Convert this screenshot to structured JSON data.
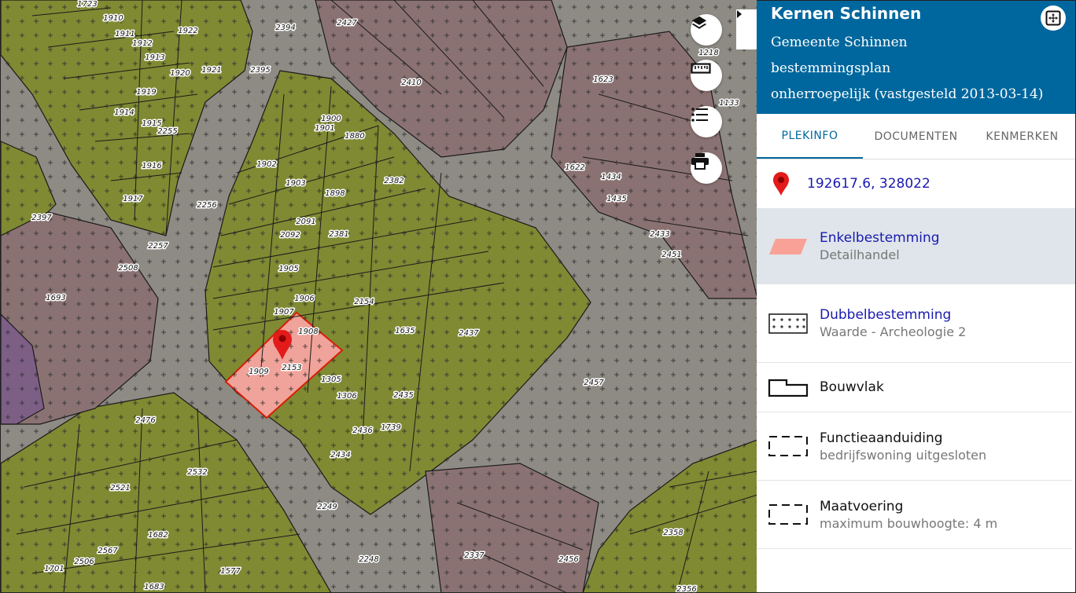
{
  "map": {
    "parcels": [
      "1723",
      "1910",
      "1911",
      "1912",
      "1913",
      "1922",
      "1920",
      "1921",
      "1919",
      "1914",
      "1915",
      "2255",
      "1916",
      "1917",
      "2256",
      "2397",
      "2257",
      "2508",
      "1693",
      "2394",
      "2395",
      "2427",
      "2410",
      "1623",
      "1218",
      "1133",
      "1622",
      "1434",
      "1435",
      "2433",
      "2451",
      "1900",
      "1901",
      "1880",
      "1902",
      "1903",
      "1898",
      "2382",
      "2091",
      "2092",
      "2381",
      "1905",
      "1906",
      "2154",
      "1907",
      "1908",
      "1635",
      "2437",
      "1909",
      "2153",
      "1305",
      "1306",
      "2435",
      "1739",
      "2436",
      "2434",
      "2457",
      "2476",
      "2532",
      "2521",
      "2249",
      "2506",
      "2567",
      "1682",
      "1701",
      "1577",
      "2248",
      "2337",
      "2456",
      "2358",
      "1683",
      "2356"
    ],
    "marker": "location-marker"
  },
  "controls": {
    "layers": "layers-icon",
    "measure": "ruler-icon",
    "legend": "list-icon",
    "print": "printer-icon"
  },
  "panel": {
    "title": "Kernen Schinnen",
    "lines": [
      "Gemeente Schinnen",
      "bestemmingsplan",
      "onherroepelijk (vastgesteld 2013-03-14)"
    ],
    "tabs": [
      "PLEKINFO",
      "DOCUMENTEN",
      "KENMERKEN"
    ],
    "active_tab": "PLEKINFO",
    "coordinates": "192617.6, 328022",
    "legend": [
      {
        "title": "Enkelbestemming",
        "sub": "Detailhandel",
        "link": true,
        "selected": true,
        "symbol": "salmon-parallelogram"
      },
      {
        "title": "Dubbelbestemming",
        "sub": "Waarde - Archeologie 2",
        "link": true,
        "selected": false,
        "symbol": "cross-hatch-box"
      },
      {
        "title": "Bouwvlak",
        "sub": "",
        "link": false,
        "selected": false,
        "symbol": "building-outline"
      },
      {
        "title": "Functieaanduiding",
        "sub": "bedrijfswoning uitgesloten",
        "link": false,
        "selected": false,
        "symbol": "dashed-box"
      },
      {
        "title": "Maatvoering",
        "sub": "maximum bouwhoogte: 4 m",
        "link": false,
        "selected": false,
        "symbol": "dashed-box"
      }
    ]
  },
  "colors": {
    "header_bg": "#00679e",
    "olive_zone": "#7d8a2e",
    "pink_zone": "#8a6e6e",
    "selected_parcel": "#f4a29a"
  }
}
